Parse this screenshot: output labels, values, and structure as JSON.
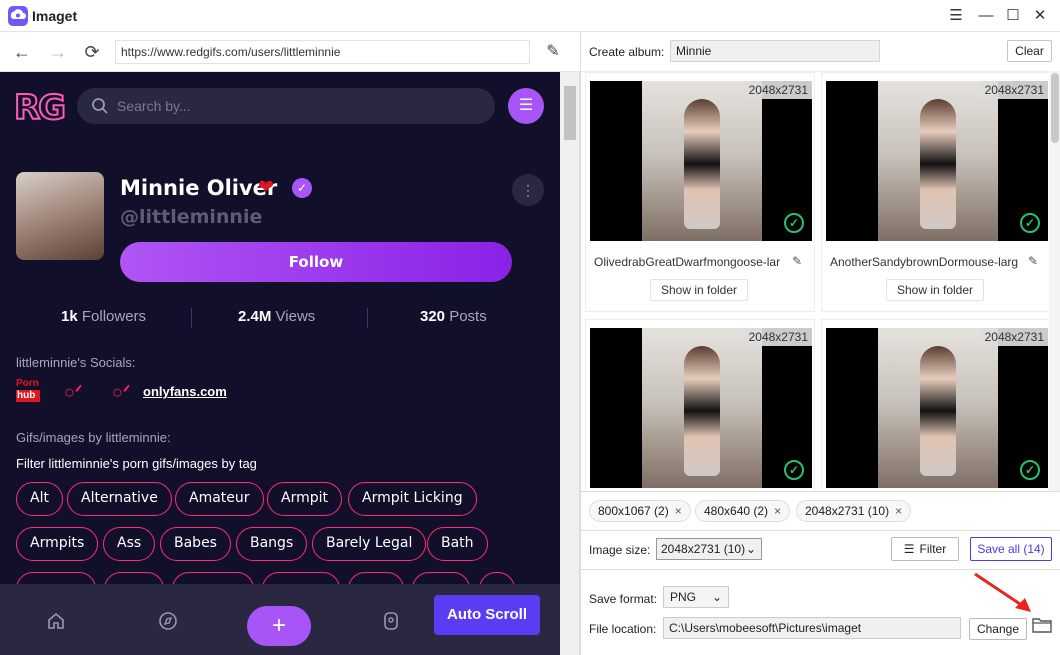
{
  "app": {
    "title": "Imaget"
  },
  "window": {
    "menu": "☰",
    "minimize": "—",
    "maximize": "☐",
    "close": "✕"
  },
  "nav": {
    "back": "←",
    "forward": "→",
    "reload": "⟳",
    "url": "https://www.redgifs.com/users/littleminnie",
    "extension": "✎"
  },
  "site": {
    "logo": "RG",
    "search_placeholder": "Search by...",
    "profile": {
      "name": "Minnie Oliver",
      "handle": "@littleminnie",
      "follow": "Follow"
    },
    "stats": [
      {
        "value": "1k",
        "label": "Followers"
      },
      {
        "value": "2.4M",
        "label": "Views"
      },
      {
        "value": "320",
        "label": "Posts"
      }
    ],
    "socials_title": "littleminnie's Socials:",
    "socials": {
      "pornhub_top": "Porn",
      "pornhub_bottom": "hub",
      "onlyfans_link": "onlyfans.com"
    },
    "gallery_title": "Gifs/images by littleminnie:",
    "filter_text": "Filter littleminnie's porn gifs/images by tag",
    "tags_row1": [
      "Alt",
      "Alternative",
      "Amateur",
      "Armpit",
      "Armpit Licking"
    ],
    "tags_row2": [
      "Armpits",
      "Ass",
      "Babes",
      "Bangs",
      "Barely Legal",
      "Bath"
    ],
    "auto_scroll": "Auto Scroll"
  },
  "panel": {
    "album_label": "Create album:",
    "album_value": "Minnie",
    "clear": "Clear",
    "images": [
      {
        "dim": "2048x2731",
        "name": "OlivedrabGreatDwarfmongoose-lar",
        "show": "Show in folder"
      },
      {
        "dim": "2048x2731",
        "name": "AnotherSandybrownDormouse-larg",
        "show": "Show in folder"
      },
      {
        "dim": "2048x2731",
        "name": "",
        "show": ""
      },
      {
        "dim": "2048x2731",
        "name": "",
        "show": ""
      }
    ],
    "chips": [
      {
        "label": "800x1067 (2)"
      },
      {
        "label": "480x640 (2)"
      },
      {
        "label": "2048x2731 (10)"
      }
    ],
    "image_size_label": "Image size:",
    "image_size_value": "2048x2731 (10)",
    "filter": "Filter",
    "save_all": "Save all (14)",
    "format_label": "Save format:",
    "format_value": "PNG",
    "location_label": "File location:",
    "location_value": "C:\\Users\\mobeesoft\\Pictures\\imaget",
    "change": "Change"
  },
  "colors": {
    "accent": "#a855f7",
    "tag_border": "#ff2d74",
    "page_bg": "#120f2b",
    "annotation_arrow": "#e8241c",
    "check": "#27c26b"
  }
}
